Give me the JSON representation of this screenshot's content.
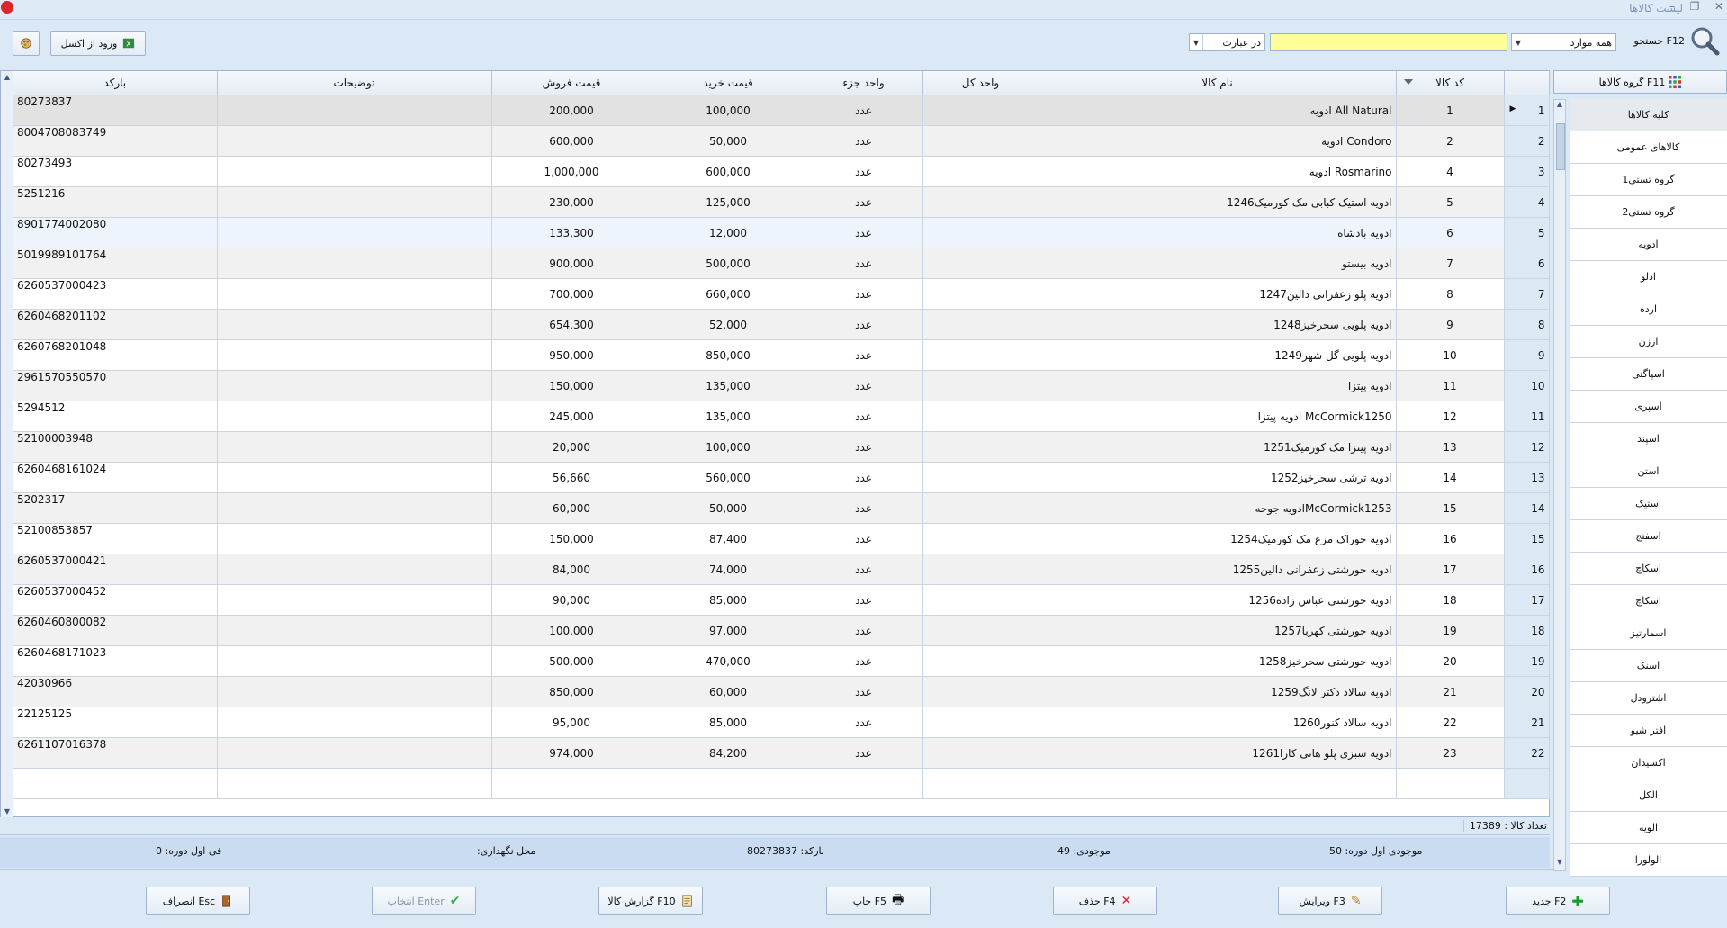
{
  "window": {
    "title": "لیست کالاها"
  },
  "toolbar": {
    "search_label": "جستجو F12",
    "scope_value": "همه موارد",
    "match_value": "در عبارت",
    "search_value": "",
    "excel_button": "ورود از اکسل"
  },
  "columns": {
    "code": "کد کالا",
    "name": "نام کالا",
    "unit_whole": "واحد کل",
    "unit_part": "واحد جزء",
    "buy_price": "قیمت خرید",
    "sell_price": "قیمت فروش",
    "description": "توضیحات",
    "barcode": "بارکد"
  },
  "rows": [
    {
      "num": "1",
      "code": "1",
      "name": "ادویه All Natural",
      "unit_whole": "",
      "unit_part": "عدد",
      "buy": "100,000",
      "sell": "200,000",
      "desc": "",
      "barcode": "80273837"
    },
    {
      "num": "2",
      "code": "2",
      "name": "ادویه Condoro",
      "unit_whole": "",
      "unit_part": "عدد",
      "buy": "50,000",
      "sell": "600,000",
      "desc": "",
      "barcode": "8004708083749"
    },
    {
      "num": "3",
      "code": "4",
      "name": "ادویه Rosmarino",
      "unit_whole": "",
      "unit_part": "عدد",
      "buy": "600,000",
      "sell": "1,000,000",
      "desc": "",
      "barcode": "80273493"
    },
    {
      "num": "4",
      "code": "5",
      "name": "ادویه استیک کبابی مک کورمیک1246",
      "unit_whole": "",
      "unit_part": "عدد",
      "buy": "125,000",
      "sell": "230,000",
      "desc": "",
      "barcode": "5251216"
    },
    {
      "num": "5",
      "code": "6",
      "name": "ادویه بادشاه",
      "unit_whole": "",
      "unit_part": "عدد",
      "buy": "12,000",
      "sell": "133,300",
      "desc": "",
      "barcode": "8901774002080"
    },
    {
      "num": "6",
      "code": "7",
      "name": "ادویه بیستو",
      "unit_whole": "",
      "unit_part": "عدد",
      "buy": "500,000",
      "sell": "900,000",
      "desc": "",
      "barcode": "5019989101764"
    },
    {
      "num": "7",
      "code": "8",
      "name": "ادویه پلو زعفرانی دالین1247",
      "unit_whole": "",
      "unit_part": "عدد",
      "buy": "660,000",
      "sell": "700,000",
      "desc": "",
      "barcode": "6260537000423"
    },
    {
      "num": "8",
      "code": "9",
      "name": "ادویه پلویی سحرخیز1248",
      "unit_whole": "",
      "unit_part": "عدد",
      "buy": "52,000",
      "sell": "654,300",
      "desc": "",
      "barcode": "6260468201102"
    },
    {
      "num": "9",
      "code": "10",
      "name": "ادویه پلویی گل شهر1249",
      "unit_whole": "",
      "unit_part": "عدد",
      "buy": "850,000",
      "sell": "950,000",
      "desc": "",
      "barcode": "6260768201048"
    },
    {
      "num": "10",
      "code": "11",
      "name": "ادویه پیتزا",
      "unit_whole": "",
      "unit_part": "عدد",
      "buy": "135,000",
      "sell": "150,000",
      "desc": "",
      "barcode": "2961570550570"
    },
    {
      "num": "11",
      "code": "12",
      "name": "ادویه پیتزا McCormick1250",
      "unit_whole": "",
      "unit_part": "عدد",
      "buy": "135,000",
      "sell": "245,000",
      "desc": "",
      "barcode": "5294512"
    },
    {
      "num": "12",
      "code": "13",
      "name": "ادویه پیتزا مک کورمیک1251",
      "unit_whole": "",
      "unit_part": "عدد",
      "buy": "100,000",
      "sell": "20,000",
      "desc": "",
      "barcode": "52100003948"
    },
    {
      "num": "13",
      "code": "14",
      "name": "ادویه ترشی سحرخیز1252",
      "unit_whole": "",
      "unit_part": "عدد",
      "buy": "560,000",
      "sell": "56,660",
      "desc": "",
      "barcode": "6260468161024"
    },
    {
      "num": "14",
      "code": "15",
      "name": "ادویه جوجهMcCormick1253",
      "unit_whole": "",
      "unit_part": "عدد",
      "buy": "50,000",
      "sell": "60,000",
      "desc": "",
      "barcode": "5202317"
    },
    {
      "num": "15",
      "code": "16",
      "name": "ادویه خوراک مرغ مک کورمیک1254",
      "unit_whole": "",
      "unit_part": "عدد",
      "buy": "87,400",
      "sell": "150,000",
      "desc": "",
      "barcode": "52100853857"
    },
    {
      "num": "16",
      "code": "17",
      "name": "ادویه خورشتی زعفرانی دالین1255",
      "unit_whole": "",
      "unit_part": "عدد",
      "buy": "74,000",
      "sell": "84,000",
      "desc": "",
      "barcode": "6260537000421"
    },
    {
      "num": "17",
      "code": "18",
      "name": "ادویه خورشتی عباس زاده1256",
      "unit_whole": "",
      "unit_part": "عدد",
      "buy": "85,000",
      "sell": "90,000",
      "desc": "",
      "barcode": "6260537000452"
    },
    {
      "num": "18",
      "code": "19",
      "name": "ادویه خورشتی کهربا1257",
      "unit_whole": "",
      "unit_part": "عدد",
      "buy": "97,000",
      "sell": "100,000",
      "desc": "",
      "barcode": "6260460800082"
    },
    {
      "num": "19",
      "code": "20",
      "name": "ادویه خورشتی سحرخیز1258",
      "unit_whole": "",
      "unit_part": "عدد",
      "buy": "470,000",
      "sell": "500,000",
      "desc": "",
      "barcode": "6260468171023"
    },
    {
      "num": "20",
      "code": "21",
      "name": "ادویه سالاد دکتر لانگ1259",
      "unit_whole": "",
      "unit_part": "عدد",
      "buy": "60,000",
      "sell": "850,000",
      "desc": "",
      "barcode": "42030966"
    },
    {
      "num": "21",
      "code": "22",
      "name": "ادویه سالاد کنور1260",
      "unit_whole": "",
      "unit_part": "عدد",
      "buy": "85,000",
      "sell": "95,000",
      "desc": "",
      "barcode": "22125125"
    },
    {
      "num": "22",
      "code": "23",
      "name": "ادویه سبزی پلو هاتی کارا1261",
      "unit_whole": "",
      "unit_part": "عدد",
      "buy": "84,200",
      "sell": "974,000",
      "desc": "",
      "barcode": "6261107016378"
    }
  ],
  "count_label": "تعداد کالا : 17389",
  "status": {
    "stock_start": "موجودی اول دوره: 50",
    "stock": "موجودی: 49",
    "barcode": "بارکد: 80273837",
    "location": "محل نگهداری:",
    "price_start": "فی اول دوره: 0"
  },
  "buttons": {
    "new": "جدید F2",
    "edit": "ویرایش F3",
    "delete": "حذف F4",
    "print": "چاپ F5",
    "report": "گزارش کالا F10",
    "select": "انتخاب Enter",
    "cancel": "انصراف Esc"
  },
  "groups": {
    "header": "گروه کالاها F11",
    "items": [
      "کلیه کالاها",
      "کالاهای عمومی",
      "گروه تستی1",
      "گروه تستی2",
      "ادویه",
      "ادلو",
      "ارده",
      "ارزن",
      "اسپاگتی",
      "اسپری",
      "اسپند",
      "استن",
      "استیک",
      "اسفنج",
      "اسکاچ",
      "اسکاچ",
      "اسمارتیز",
      "اسنک",
      "اشترودل",
      "افتر شیو",
      "اکسیدان",
      "الکل",
      "الویه",
      "الولورا"
    ]
  },
  "colors": {
    "accent": "#dbe8f6",
    "status": "#c9dcf2",
    "search_yellow": "#ffff99"
  }
}
